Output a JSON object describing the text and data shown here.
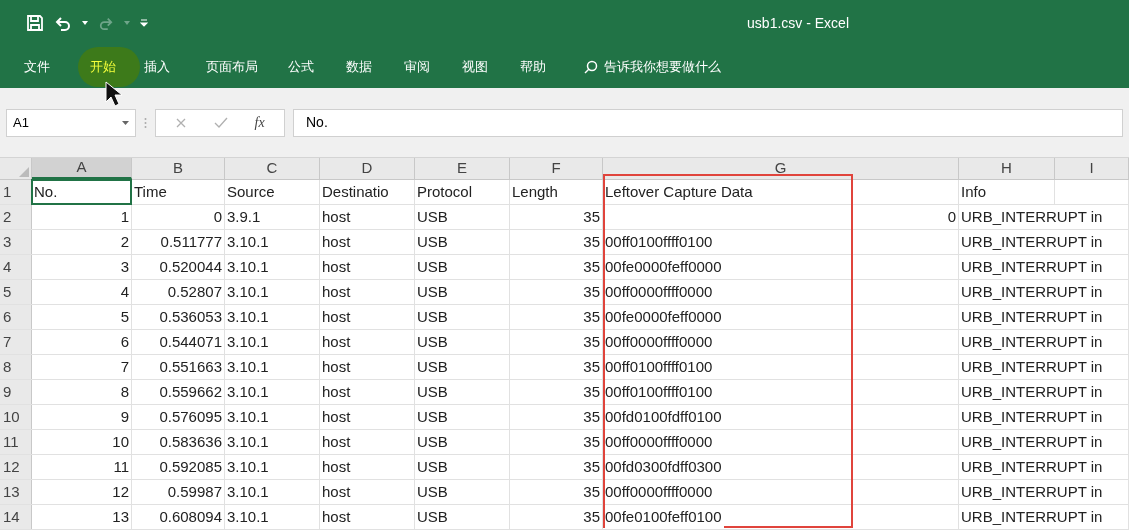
{
  "window": {
    "title": "usb1.csv  -  Excel"
  },
  "tabs": [
    {
      "label": "文件",
      "highlighted": false
    },
    {
      "label": "开始",
      "highlighted": true
    },
    {
      "label": "插入",
      "highlighted": false
    },
    {
      "label": "页面布局",
      "highlighted": false
    },
    {
      "label": "公式",
      "highlighted": false
    },
    {
      "label": "数据",
      "highlighted": false
    },
    {
      "label": "审阅",
      "highlighted": false
    },
    {
      "label": "视图",
      "highlighted": false
    },
    {
      "label": "帮助",
      "highlighted": false
    }
  ],
  "tell_me": {
    "placeholder": "告诉我你想要做什么"
  },
  "name_box": {
    "value": "A1"
  },
  "formula_bar": {
    "function_label": "fx",
    "value": "No."
  },
  "columns": [
    {
      "label": "A",
      "selected": true
    },
    {
      "label": "B",
      "selected": false
    },
    {
      "label": "C",
      "selected": false
    },
    {
      "label": "D",
      "selected": false
    },
    {
      "label": "E",
      "selected": false
    },
    {
      "label": "F",
      "selected": false
    },
    {
      "label": "G",
      "selected": false
    },
    {
      "label": "H",
      "selected": false
    },
    {
      "label": "I",
      "selected": false
    }
  ],
  "rows": [
    {
      "number": "1",
      "cells": [
        {
          "text": "No.",
          "kind": "text",
          "selected": true
        },
        {
          "text": "Time",
          "kind": "text"
        },
        {
          "text": "Source",
          "kind": "text"
        },
        {
          "text": "Destinatio",
          "kind": "text"
        },
        {
          "text": "Protocol",
          "kind": "text"
        },
        {
          "text": "Length",
          "kind": "text"
        },
        {
          "text": "Leftover Capture Data",
          "kind": "text"
        },
        {
          "text": "Info",
          "kind": "text"
        }
      ]
    },
    {
      "number": "2",
      "cells": [
        {
          "text": "1",
          "kind": "number"
        },
        {
          "text": "0",
          "kind": "number"
        },
        {
          "text": "3.9.1",
          "kind": "text"
        },
        {
          "text": "host",
          "kind": "text"
        },
        {
          "text": "USB",
          "kind": "text"
        },
        {
          "text": "35",
          "kind": "number"
        },
        {
          "text": "0",
          "kind": "number"
        },
        {
          "text": "URB_INTERRUPT in",
          "kind": "text"
        }
      ]
    },
    {
      "number": "3",
      "cells": [
        {
          "text": "2",
          "kind": "number"
        },
        {
          "text": "0.511777",
          "kind": "number"
        },
        {
          "text": "3.10.1",
          "kind": "text"
        },
        {
          "text": "host",
          "kind": "text"
        },
        {
          "text": "USB",
          "kind": "text"
        },
        {
          "text": "35",
          "kind": "number"
        },
        {
          "text": "00ff0100ffff0100",
          "kind": "text"
        },
        {
          "text": "URB_INTERRUPT in",
          "kind": "text"
        }
      ]
    },
    {
      "number": "4",
      "cells": [
        {
          "text": "3",
          "kind": "number"
        },
        {
          "text": "0.520044",
          "kind": "number"
        },
        {
          "text": "3.10.1",
          "kind": "text"
        },
        {
          "text": "host",
          "kind": "text"
        },
        {
          "text": "USB",
          "kind": "text"
        },
        {
          "text": "35",
          "kind": "number"
        },
        {
          "text": "00fe0000feff0000",
          "kind": "text"
        },
        {
          "text": "URB_INTERRUPT in",
          "kind": "text"
        }
      ]
    },
    {
      "number": "5",
      "cells": [
        {
          "text": "4",
          "kind": "number"
        },
        {
          "text": "0.52807",
          "kind": "number"
        },
        {
          "text": "3.10.1",
          "kind": "text"
        },
        {
          "text": "host",
          "kind": "text"
        },
        {
          "text": "USB",
          "kind": "text"
        },
        {
          "text": "35",
          "kind": "number"
        },
        {
          "text": "00ff0000ffff0000",
          "kind": "text"
        },
        {
          "text": "URB_INTERRUPT in",
          "kind": "text"
        }
      ]
    },
    {
      "number": "6",
      "cells": [
        {
          "text": "5",
          "kind": "number"
        },
        {
          "text": "0.536053",
          "kind": "number"
        },
        {
          "text": "3.10.1",
          "kind": "text"
        },
        {
          "text": "host",
          "kind": "text"
        },
        {
          "text": "USB",
          "kind": "text"
        },
        {
          "text": "35",
          "kind": "number"
        },
        {
          "text": "00fe0000feff0000",
          "kind": "text"
        },
        {
          "text": "URB_INTERRUPT in",
          "kind": "text"
        }
      ]
    },
    {
      "number": "7",
      "cells": [
        {
          "text": "6",
          "kind": "number"
        },
        {
          "text": "0.544071",
          "kind": "number"
        },
        {
          "text": "3.10.1",
          "kind": "text"
        },
        {
          "text": "host",
          "kind": "text"
        },
        {
          "text": "USB",
          "kind": "text"
        },
        {
          "text": "35",
          "kind": "number"
        },
        {
          "text": "00ff0000ffff0000",
          "kind": "text"
        },
        {
          "text": "URB_INTERRUPT in",
          "kind": "text"
        }
      ]
    },
    {
      "number": "8",
      "cells": [
        {
          "text": "7",
          "kind": "number"
        },
        {
          "text": "0.551663",
          "kind": "number"
        },
        {
          "text": "3.10.1",
          "kind": "text"
        },
        {
          "text": "host",
          "kind": "text"
        },
        {
          "text": "USB",
          "kind": "text"
        },
        {
          "text": "35",
          "kind": "number"
        },
        {
          "text": "00ff0100ffff0100",
          "kind": "text"
        },
        {
          "text": "URB_INTERRUPT in",
          "kind": "text"
        }
      ]
    },
    {
      "number": "9",
      "cells": [
        {
          "text": "8",
          "kind": "number"
        },
        {
          "text": "0.559662",
          "kind": "number"
        },
        {
          "text": "3.10.1",
          "kind": "text"
        },
        {
          "text": "host",
          "kind": "text"
        },
        {
          "text": "USB",
          "kind": "text"
        },
        {
          "text": "35",
          "kind": "number"
        },
        {
          "text": "00ff0100ffff0100",
          "kind": "text"
        },
        {
          "text": "URB_INTERRUPT in",
          "kind": "text"
        }
      ]
    },
    {
      "number": "10",
      "cells": [
        {
          "text": "9",
          "kind": "number"
        },
        {
          "text": "0.576095",
          "kind": "number"
        },
        {
          "text": "3.10.1",
          "kind": "text"
        },
        {
          "text": "host",
          "kind": "text"
        },
        {
          "text": "USB",
          "kind": "text"
        },
        {
          "text": "35",
          "kind": "number"
        },
        {
          "text": "00fd0100fdff0100",
          "kind": "text"
        },
        {
          "text": "URB_INTERRUPT in",
          "kind": "text"
        }
      ]
    },
    {
      "number": "11",
      "cells": [
        {
          "text": "10",
          "kind": "number"
        },
        {
          "text": "0.583636",
          "kind": "number"
        },
        {
          "text": "3.10.1",
          "kind": "text"
        },
        {
          "text": "host",
          "kind": "text"
        },
        {
          "text": "USB",
          "kind": "text"
        },
        {
          "text": "35",
          "kind": "number"
        },
        {
          "text": "00ff0000ffff0000",
          "kind": "text"
        },
        {
          "text": "URB_INTERRUPT in",
          "kind": "text"
        }
      ]
    },
    {
      "number": "12",
      "cells": [
        {
          "text": "11",
          "kind": "number"
        },
        {
          "text": "0.592085",
          "kind": "number"
        },
        {
          "text": "3.10.1",
          "kind": "text"
        },
        {
          "text": "host",
          "kind": "text"
        },
        {
          "text": "USB",
          "kind": "text"
        },
        {
          "text": "35",
          "kind": "number"
        },
        {
          "text": "00fd0300fdff0300",
          "kind": "text"
        },
        {
          "text": "URB_INTERRUPT in",
          "kind": "text"
        }
      ]
    },
    {
      "number": "13",
      "cells": [
        {
          "text": "12",
          "kind": "number"
        },
        {
          "text": "0.59987",
          "kind": "number"
        },
        {
          "text": "3.10.1",
          "kind": "text"
        },
        {
          "text": "host",
          "kind": "text"
        },
        {
          "text": "USB",
          "kind": "text"
        },
        {
          "text": "35",
          "kind": "number"
        },
        {
          "text": "00ff0000ffff0000",
          "kind": "text"
        },
        {
          "text": "URB_INTERRUPT in",
          "kind": "text"
        }
      ]
    },
    {
      "number": "14",
      "cells": [
        {
          "text": "13",
          "kind": "number"
        },
        {
          "text": "0.608094",
          "kind": "number"
        },
        {
          "text": "3.10.1",
          "kind": "text"
        },
        {
          "text": "host",
          "kind": "text"
        },
        {
          "text": "USB",
          "kind": "text"
        },
        {
          "text": "35",
          "kind": "number"
        },
        {
          "text": "00fe0100feff0100",
          "kind": "text"
        },
        {
          "text": "URB_INTERRUPT in",
          "kind": "text"
        }
      ]
    }
  ]
}
